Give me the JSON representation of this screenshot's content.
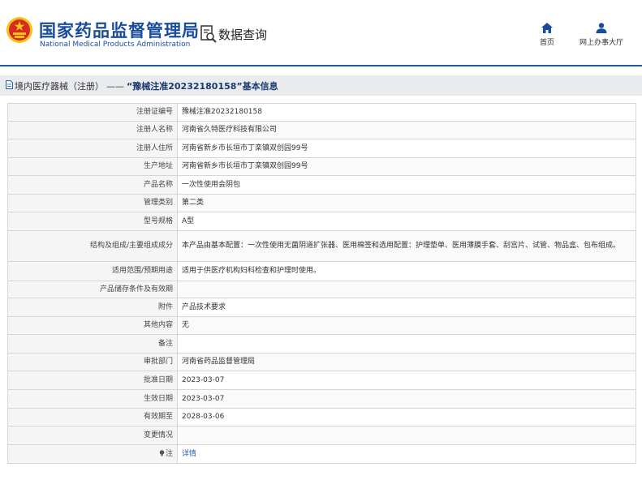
{
  "header": {
    "org_name_cn": "国家药品监督管理局",
    "org_name_en": "National Medical Products Administration",
    "query_label": "数据查询",
    "nav": [
      {
        "label": "首页",
        "icon": "home-icon"
      },
      {
        "label": "网上办事大厅",
        "icon": "user-icon"
      }
    ]
  },
  "breadcrumb": {
    "category": "境内医疗器械（注册）",
    "separator": "——",
    "title": "“豫械注准20232180158”基本信息"
  },
  "details": [
    {
      "label": "注册证编号",
      "value": "豫械注准20232180158"
    },
    {
      "label": "注册人名称",
      "value": "河南省久特医疗科技有限公司"
    },
    {
      "label": "注册人住所",
      "value": "河南省新乡市长垣市丁栾镇双创园99号"
    },
    {
      "label": "生产地址",
      "value": "河南省新乡市长垣市丁栾镇双创园99号"
    },
    {
      "label": "产品名称",
      "value": "一次性使用会阴包"
    },
    {
      "label": "管理类别",
      "value": "第二类"
    },
    {
      "label": "型号规格",
      "value": "A型"
    },
    {
      "label": "结构及组成/主要组成成分",
      "value": "本产品由基本配置：一次性使用无菌阴道扩张器、医用棉签和选用配置：护理垫单、医用薄膜手套、刮宫片、试管、物品盒、包布组成。"
    },
    {
      "label": "适用范围/预期用途",
      "value": "适用于供医疗机构妇科检查和护理时使用。"
    },
    {
      "label": "产品储存条件及有效期",
      "value": ""
    },
    {
      "label": "附件",
      "value": "产品技术要求"
    },
    {
      "label": "其他内容",
      "value": "无"
    },
    {
      "label": "备注",
      "value": ""
    },
    {
      "label": "审批部门",
      "value": "河南省药品监督管理局"
    },
    {
      "label": "批准日期",
      "value": "2023-03-07"
    },
    {
      "label": "生效日期",
      "value": "2023-03-07"
    },
    {
      "label": "有效期至",
      "value": "2028-03-06"
    },
    {
      "label": "变更情况",
      "value": ""
    }
  ],
  "note": {
    "label": "注",
    "link_text": "详情",
    "icon": "lightbulb-icon"
  },
  "colors": {
    "brand_blue": "#1a4c9c",
    "link_blue": "#2260b3",
    "emblem_red": "#d62b20",
    "emblem_gold": "#f2c21b"
  }
}
